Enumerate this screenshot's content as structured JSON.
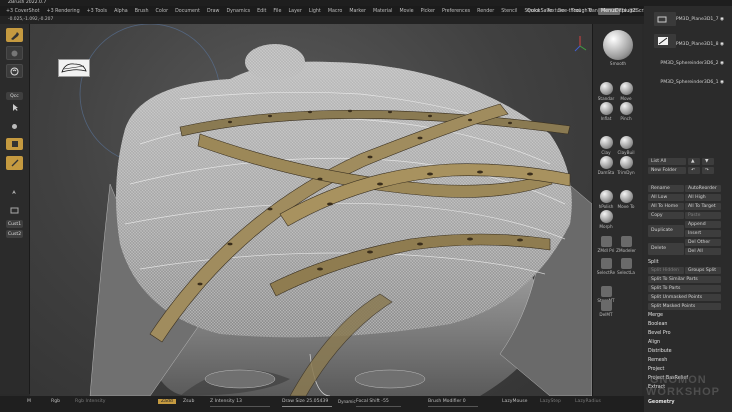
{
  "title_bar": {
    "title": "ZBrush 2022.0.7"
  },
  "menu": {
    "items": [
      "+3 CoverShot",
      "+3 Rendering",
      "+3 Tools",
      "Alpha",
      "Brush",
      "Color",
      "Document",
      "Draw",
      "Dynamics",
      "Edit",
      "File",
      "Layer",
      "Light",
      "Macro",
      "Marker",
      "Material",
      "Movie",
      "Picker",
      "Preferences",
      "Render",
      "Stencil",
      "Stroke",
      "Texture",
      "Tool",
      "Transform",
      "Zplugin",
      "Zscript",
      "Help"
    ],
    "quicksave": "QuickSave",
    "see_through": "See-through",
    "see_through_value": "0",
    "menus": "Menus",
    "default_script": "DefaultZScript"
  },
  "status": {
    "coords": "-0.025,-1.092,-0.207"
  },
  "left_shelf": {
    "qcc_label": "Qcc",
    "cust1": "Cust1",
    "cust2": "Cust2"
  },
  "right_shelf": {
    "smooth": "Smooth",
    "brushes": [
      "Standar",
      "Move",
      "Inflat",
      "Pinch",
      "Clay",
      "ClayBuil",
      "DamSta",
      "TrimDyn",
      "hPolish",
      "Move To",
      "Morph",
      "ZMdl Pri",
      "ZModeler",
      "SelectRe",
      "SelectLa",
      "StoreMT",
      "DelMT"
    ],
    "icons": [
      "standard-brush-icon",
      "move-brush-icon",
      "inflate-brush-icon",
      "pinch-brush-icon",
      "clay-brush-icon",
      "claybuildup-brush-icon",
      "damstandard-brush-icon",
      "trimdynamic-brush-icon"
    ]
  },
  "subtool": {
    "items": [
      "PM3D_Plane3D1_7",
      "PM3D_Plane3D1_8",
      "PM3D_Sphereinder3D6_2",
      "PM3D_Sphereinder3D6_1"
    ],
    "list_all": "List All",
    "new_folder": "New Folder",
    "rename": "Rename",
    "auto_reorder": "AutoReorder",
    "all_low": "All Low",
    "all_high": "All High",
    "all_to_home": "All To Home",
    "all_to_target": "All To Target",
    "copy": "Copy",
    "paste": "Paste",
    "duplicate": "Duplicate",
    "append": "Append",
    "insert": "Insert",
    "delete": "Delete",
    "del_other": "Del Other",
    "del_all": "Del All",
    "split_section": "Split",
    "split_hidden": "Split Hidden",
    "groups_split": "Groups Split",
    "split_similar": "Split To Similar Parts",
    "split_parts": "Split To Parts",
    "split_unmasked": "Split Unmasked Points",
    "split_masked": "Split Masked Points",
    "merge": "Merge",
    "boolean": "Boolean",
    "bevel_pro": "Bevel Pro",
    "align": "Align",
    "distribute": "Distribute",
    "remesh": "Remesh",
    "project": "Project",
    "project_bas_relief": "Project BasRelief",
    "extract": "Extract",
    "geometry": "Geometry"
  },
  "bottom": {
    "m": "M",
    "rgb": "Rgb",
    "rgb_intensity": "Rgb Intensity",
    "zadd": "Zadd",
    "zsub": "Zsub",
    "z_intensity_label": "Z Intensity",
    "z_intensity_value": "13",
    "draw_size_label": "Draw Size",
    "draw_size_value": "25.05439",
    "dynamic": "Dynamic",
    "focal_shift_label": "Focal Shift",
    "focal_shift_value": "-55",
    "brush_modifier_label": "Brush Modifier",
    "brush_modifier_value": "0",
    "lazymouse": "LazyMouse",
    "lazystep": "LazyStep",
    "lazyradius": "LazyRadius"
  },
  "watermark": {
    "line1": "GNOMON",
    "line2": "WORKSHOP"
  },
  "colors": {
    "accent": "#c59a40",
    "panel": "#2b2b2b",
    "button": "#3d3d3d"
  }
}
